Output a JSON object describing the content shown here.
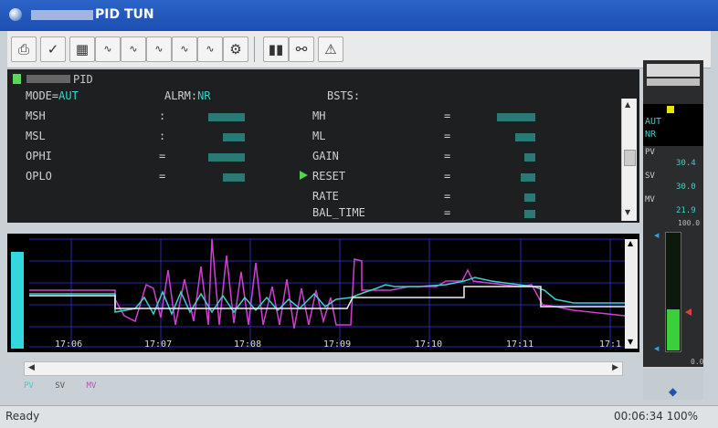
{
  "window": {
    "title": "PID TUN"
  },
  "toolbar": {
    "buttons": [
      "print-icon",
      "check-icon",
      "chart-icon",
      "trend-icon",
      "trend-icon",
      "trend-icon",
      "trend-icon",
      "trend-icon",
      "tuning-icon",
      "pause-icon",
      "tree-icon",
      "warning-icon"
    ]
  },
  "panel": {
    "header": "PID",
    "mode_label": "MODE=",
    "mode_value": "AUT",
    "alarm_label": "ALRM:",
    "alarm_value": "NR",
    "bsts_label": "BSTS:",
    "left_params": [
      {
        "name": "MSH",
        "sep": ":"
      },
      {
        "name": "MSL",
        "sep": ":"
      },
      {
        "name": "OPHI",
        "sep": "="
      },
      {
        "name": "OPLO",
        "sep": "="
      }
    ],
    "right_params": [
      {
        "name": "MH",
        "sep": "="
      },
      {
        "name": "ML",
        "sep": "="
      },
      {
        "name": "GAIN",
        "sep": "="
      },
      {
        "name": "RESET",
        "sep": "="
      },
      {
        "name": "RATE",
        "sep": "="
      },
      {
        "name": "BAL_TIME",
        "sep": "="
      }
    ]
  },
  "trend": {
    "time_labels": [
      "17:06",
      "17:07",
      "17:08",
      "17:09",
      "17:10",
      "17:11",
      "17:1"
    ],
    "legend": [
      {
        "label": "PV",
        "color": "#3fd0c8"
      },
      {
        "label": "SV",
        "color": "#e8e8e8"
      },
      {
        "label": "MV",
        "color": "#d040d0"
      }
    ]
  },
  "side": {
    "mode": "AUT",
    "alarm": "NR",
    "pv_label": "PV",
    "pv_value": "30.4",
    "sv_label": "SV",
    "sv_value": "30.0",
    "mv_label": "MV",
    "mv_value": "21.9",
    "scale_top": "100.0",
    "scale_bottom": "0.0",
    "bar_level": 0.35
  },
  "status": {
    "ready": "Ready",
    "time": "00:06:34",
    "zoom": "100%"
  }
}
